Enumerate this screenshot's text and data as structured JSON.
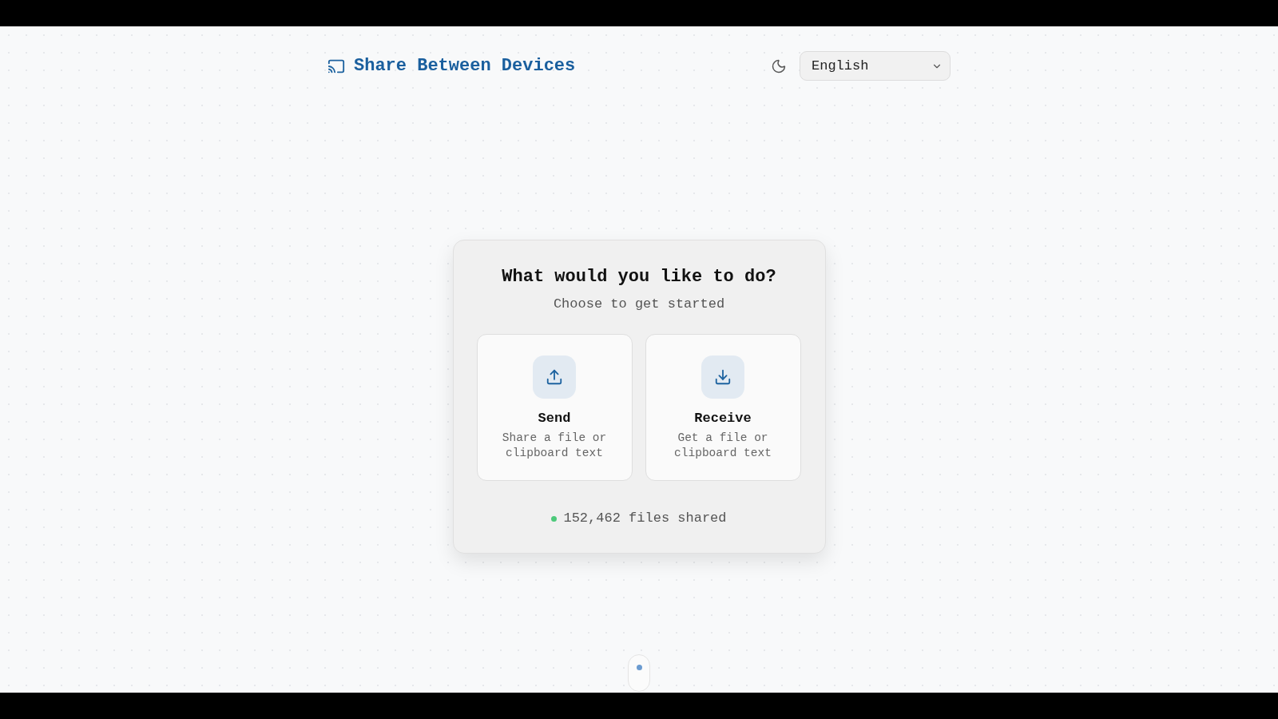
{
  "header": {
    "title": "Share Between Devices",
    "language_select": {
      "value": "English"
    }
  },
  "card": {
    "heading": "What would you like to do?",
    "subheading": "Choose to get started",
    "options": [
      {
        "kind": "upload",
        "title": "Send",
        "description": "Share a file or clipboard text"
      },
      {
        "kind": "download",
        "title": "Receive",
        "description": "Get a file or clipboard text"
      }
    ],
    "stats": {
      "text": "152,462 files shared"
    }
  }
}
